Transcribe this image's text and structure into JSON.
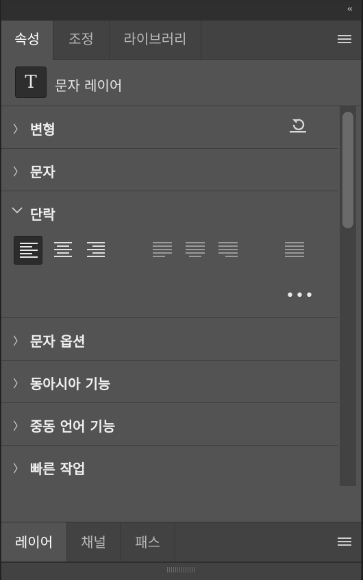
{
  "header": {
    "collapse_glyph": "‹‹"
  },
  "tabs": [
    {
      "label": "속성",
      "active": true
    },
    {
      "label": "조정",
      "active": false
    },
    {
      "label": "라이브러리",
      "active": false
    }
  ],
  "type_layer": {
    "icon_glyph": "T",
    "label": "문자 레이어"
  },
  "sections": {
    "transform": "변형",
    "character": "문자",
    "paragraph": "단락",
    "character_options": "문자 옵션",
    "east_asian": "동아시아 기능",
    "middle_eastern": "중동 언어 기능",
    "quick_actions": "빠른 작업"
  },
  "paragraph": {
    "align_buttons": [
      {
        "name": "align-left",
        "selected": true
      },
      {
        "name": "align-center",
        "selected": false
      },
      {
        "name": "align-right",
        "selected": false
      },
      {
        "name": "justify-last-left",
        "selected": false
      },
      {
        "name": "justify-last-center",
        "selected": false
      },
      {
        "name": "justify-last-right",
        "selected": false
      },
      {
        "name": "justify-all",
        "selected": false
      }
    ],
    "more_glyph": "•••"
  },
  "bottom_tabs": [
    {
      "label": "레이어",
      "active": true
    },
    {
      "label": "채널",
      "active": false
    },
    {
      "label": "패스",
      "active": false
    }
  ],
  "colors": {
    "panel": "#535353",
    "tab_bar": "#424242",
    "text": "#e6e6e6"
  }
}
